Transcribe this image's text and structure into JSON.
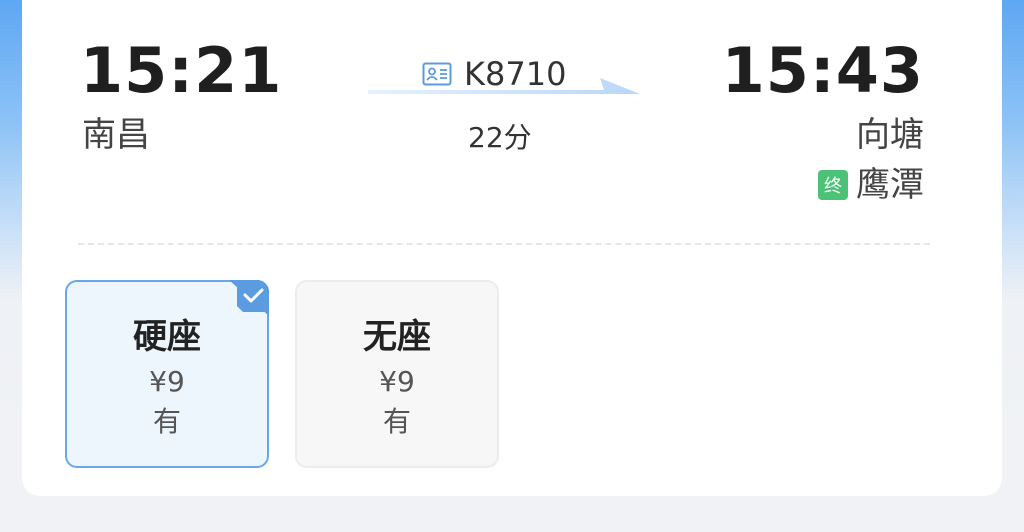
{
  "trip": {
    "departure_time": "15:21",
    "departure_station": "南昌",
    "arrival_time": "15:43",
    "arrival_station": "向塘",
    "terminal_badge": "终",
    "terminal_station": "鹰潭",
    "train_number": "K8710",
    "duration": "22分"
  },
  "seats": [
    {
      "name": "硬座",
      "price": "¥9",
      "availability": "有",
      "selected": true
    },
    {
      "name": "无座",
      "price": "¥9",
      "availability": "有",
      "selected": false
    }
  ],
  "colors": {
    "accent": "#6aa7e8",
    "terminal_badge": "#4cc277",
    "selected_bg": "#eef6fd"
  },
  "icons": {
    "train_icon": "id-card-icon",
    "check_icon": "check-icon",
    "arrow": "arrow-right-icon"
  }
}
